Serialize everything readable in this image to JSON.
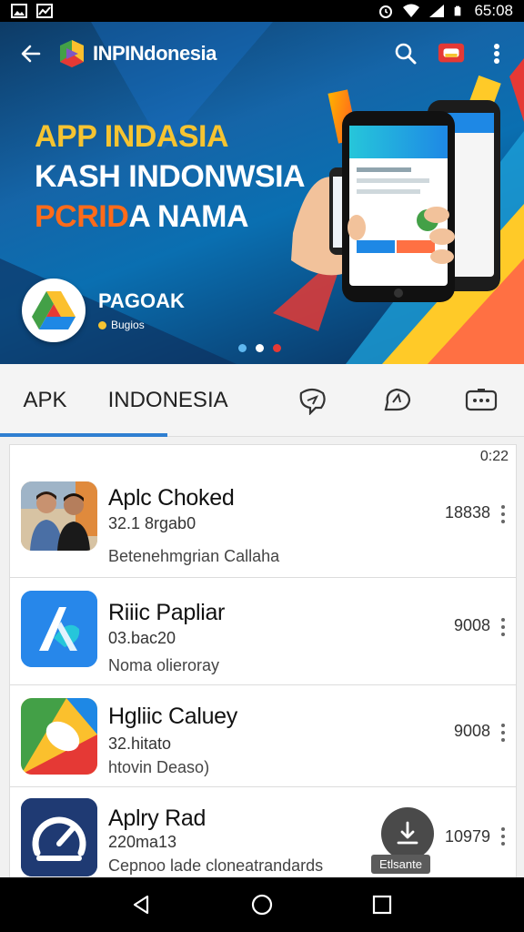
{
  "status_bar": {
    "time": "65:08"
  },
  "toolbar": {
    "brand_name": "INPINdonesia"
  },
  "hero": {
    "headline_1": "APP INDASIA",
    "headline_2": "KASH INDONWSIA",
    "headline_3_accent": "PCRID",
    "headline_3_rest": "A NAMA",
    "promo_name": "PAGOAK",
    "promo_sub": "Bugios"
  },
  "tabs": {
    "apk": "APK",
    "indonesia": "INDONESIA"
  },
  "list": {
    "time": "0:22",
    "items": [
      {
        "title": "Aplc Choked",
        "version": "32.1 8rgab0",
        "desc": "Betenehmgrian Callaha",
        "count": "18838"
      },
      {
        "title": "Riiic Papliar",
        "version": "03.bac20",
        "desc": "Noma olieroray",
        "count": "9008"
      },
      {
        "title": "Hgliic Caluey",
        "version": "32.hitato",
        "desc": "htovin Deaso)",
        "count": "9008"
      },
      {
        "title": "Aplry Rad",
        "version": "220ma13",
        "desc": "Cepnoo lade cloneatrandards",
        "count": "10979"
      }
    ],
    "install_tooltip": "Etlsante"
  },
  "colors": {
    "accent_blue": "#2f7fd1",
    "headline_yellow": "#f6c431",
    "headline_orange": "#ff6b1a",
    "dot_active": "#5fb8f0",
    "dot_red": "#e53935"
  }
}
